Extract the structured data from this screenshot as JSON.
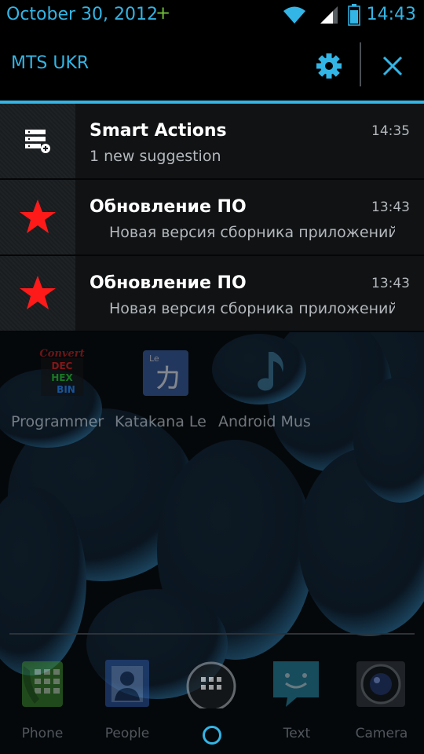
{
  "status_bar": {
    "date": "October 30, 2012",
    "plus_indicator": "+",
    "time": "14:43",
    "icons": [
      "wifi-icon",
      "cell-signal-icon",
      "battery-icon"
    ]
  },
  "shade_header": {
    "carrier": "MTS UKR",
    "settings_icon": "gear-icon",
    "clear_icon": "close-icon"
  },
  "notifications": [
    {
      "app_icon": "smart-actions-icon",
      "title": "Smart Actions",
      "text": "1 new suggestion",
      "time": "14:35"
    },
    {
      "app_icon": "red-star-icon",
      "title": "Обновление ПО",
      "text": "Новая версия сборника приложений",
      "time": "13:43"
    },
    {
      "app_icon": "red-star-icon",
      "title": "Обновление ПО",
      "text": "Новая версия сборника приложений",
      "time": "13:43"
    }
  ],
  "home_screen": {
    "apps": [
      {
        "label": "Programmer",
        "icon": "dec-hex-bin-converter-icon",
        "icon_text": {
          "top": "Convert",
          "l1": "DEC",
          "l2": "HEX",
          "l3": "BIN"
        }
      },
      {
        "label": "Katakana Le",
        "icon": "katakana-icon",
        "icon_text": {
          "corner": "Le",
          "glyph": "カ"
        }
      },
      {
        "label": "Android Mus",
        "icon": "music-note-icon"
      }
    ],
    "dock": [
      {
        "label": "Phone",
        "icon": "phone-dialer-icon"
      },
      {
        "label": "People",
        "icon": "contacts-icon"
      },
      {
        "label": "",
        "icon": "app-drawer-icon"
      },
      {
        "label": "Text",
        "icon": "messaging-icon"
      },
      {
        "label": "Camera",
        "icon": "camera-icon"
      }
    ]
  },
  "colors": {
    "accent": "#33b5e5",
    "notification_bg": "#101214",
    "title_text": "#ffffff",
    "secondary_text": "#b4b8bc",
    "star_red": "#ff1a1a"
  }
}
